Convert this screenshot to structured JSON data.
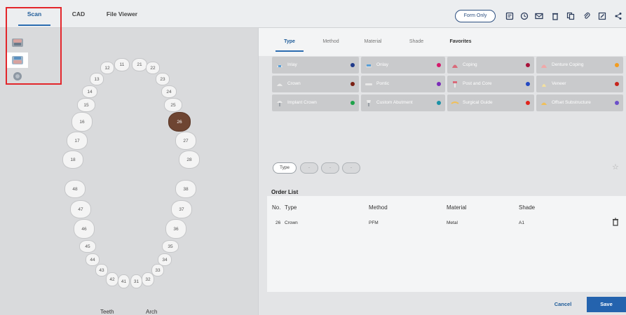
{
  "header": {
    "tabs": [
      "Scan",
      "CAD",
      "File Viewer"
    ],
    "form_only_label": "Form Only",
    "icons": [
      "notes-icon",
      "history-icon",
      "mail-icon",
      "trash-icon",
      "copy-icon",
      "attach-icon",
      "edit-icon",
      "share-icon"
    ]
  },
  "teeth": {
    "upper": [
      "11",
      "12",
      "13",
      "14",
      "15",
      "16",
      "17",
      "18",
      "21",
      "22",
      "23",
      "24",
      "25",
      "26",
      "27",
      "28"
    ],
    "lower": [
      "31",
      "32",
      "33",
      "34",
      "35",
      "36",
      "37",
      "38",
      "41",
      "42",
      "43",
      "44",
      "45",
      "46",
      "47",
      "48"
    ],
    "selected": "26"
  },
  "bottom_labels": [
    "Teeth",
    "Arch"
  ],
  "subtabs": [
    "Type",
    "Method",
    "Material",
    "Shade",
    "Favorites"
  ],
  "prosthesis_types": [
    {
      "label": "Inlay",
      "dot": "#1f3a8a"
    },
    {
      "label": "Onlay",
      "dot": "#d6186b"
    },
    {
      "label": "Coping",
      "dot": "#a8123a"
    },
    {
      "label": "Denture Coping",
      "dot": "#f39c1f"
    },
    {
      "label": "Crown",
      "dot": "#7a1f12"
    },
    {
      "label": "Pontic",
      "dot": "#7b2bb8"
    },
    {
      "label": "Post and Core",
      "dot": "#2349c2"
    },
    {
      "label": "Veneer",
      "dot": "#c7241c"
    },
    {
      "label": "Implant Crown",
      "dot": "#1ea34a"
    },
    {
      "label": "Custom Abutment",
      "dot": "#1a91a6"
    },
    {
      "label": "Surgical Guide",
      "dot": "#e0241c"
    },
    {
      "label": "Offset Substructure",
      "dot": "#6b4fc9"
    }
  ],
  "filter": {
    "first": "Type",
    "rest": [
      "-",
      "-",
      "-"
    ]
  },
  "order_list": {
    "title": "Order List",
    "columns": [
      "No.",
      "Type",
      "Method",
      "Material",
      "Shade"
    ],
    "rows": [
      {
        "no": "26",
        "type": "Crown",
        "method": "PFM",
        "material": "Metal",
        "shade": "A1"
      }
    ]
  },
  "actions": {
    "cancel": "Cancel",
    "save": "Save"
  }
}
